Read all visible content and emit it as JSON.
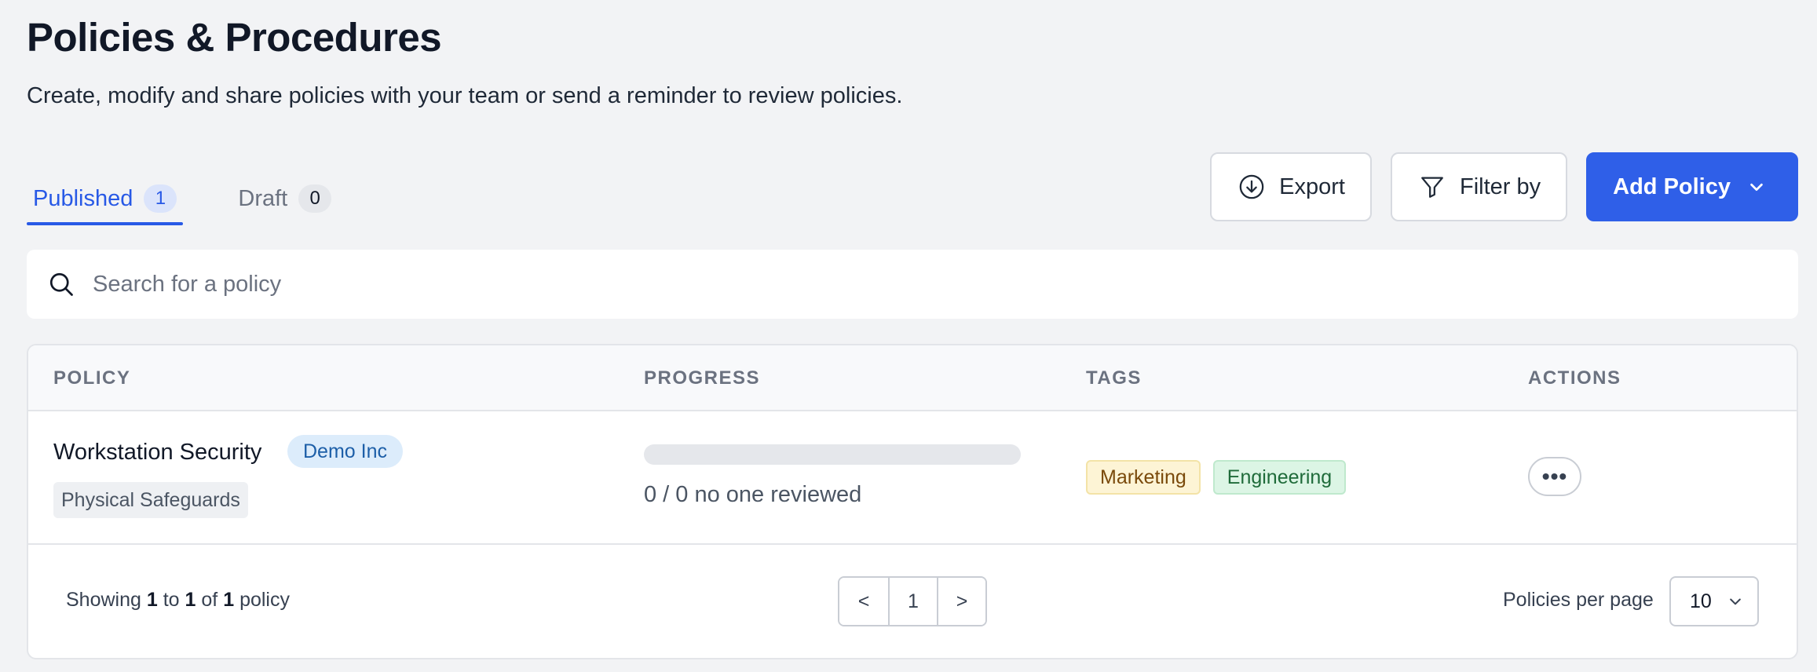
{
  "header": {
    "title": "Policies & Procedures",
    "subtitle": "Create, modify and share policies with your team or send a reminder to review policies."
  },
  "tabs": [
    {
      "label": "Published",
      "count": "1",
      "active": true
    },
    {
      "label": "Draft",
      "count": "0",
      "active": false
    }
  ],
  "toolbar": {
    "export_label": "Export",
    "filter_label": "Filter by",
    "add_label": "Add Policy"
  },
  "search": {
    "placeholder": "Search for a policy",
    "value": ""
  },
  "table": {
    "columns": [
      "POLICY",
      "PROGRESS",
      "TAGS",
      "ACTIONS"
    ],
    "rows": [
      {
        "name": "Workstation Security",
        "owner": "Demo Inc",
        "category": "Physical Safeguards",
        "progress_fraction": 0,
        "progress_text": "0 / 0 no one reviewed",
        "tags": [
          "Marketing",
          "Engineering"
        ],
        "actions_label": "•••"
      }
    ]
  },
  "footer": {
    "showing_prefix": "Showing",
    "showing_from": "1",
    "showing_to_word": "to",
    "showing_to": "1",
    "showing_of_word": "of",
    "showing_total": "1",
    "showing_suffix": "policy",
    "pager": {
      "prev": "<",
      "current": "1",
      "next": ">"
    },
    "per_page_label": "Policies per page",
    "per_page_value": "10"
  },
  "colors": {
    "accent": "#2f5fe8",
    "background": "#f2f3f5",
    "tag_marketing_bg": "#fdf4d5",
    "tag_engineering_bg": "#dcf5e5"
  },
  "icons": {
    "export": "download-circle-icon",
    "filter": "funnel-icon",
    "add_caret": "chevron-down-icon",
    "search": "search-icon",
    "per_page_caret": "chevron-down-icon"
  }
}
